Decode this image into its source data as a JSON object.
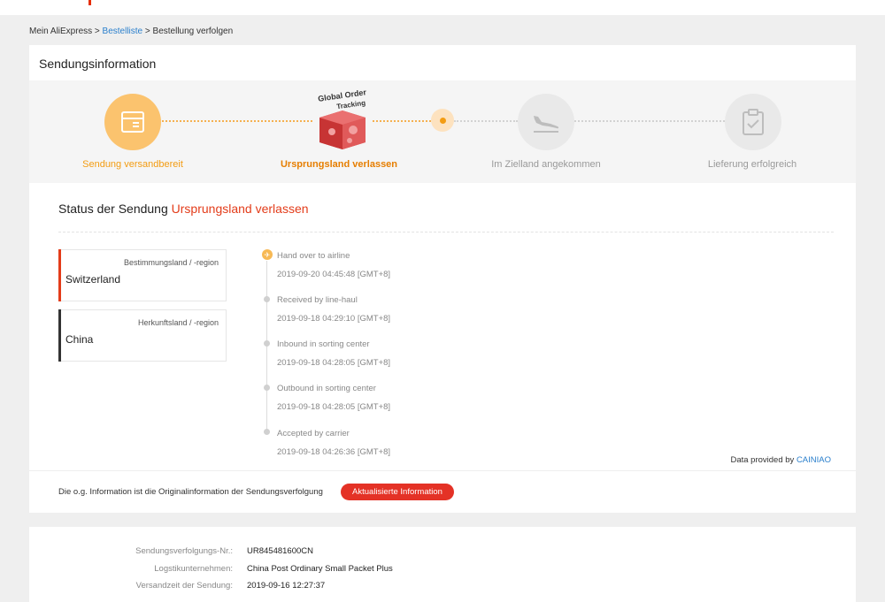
{
  "breadcrumb": {
    "home": "Mein AliExpress",
    "sep1": ">",
    "list": "Bestelliste",
    "sep2": ">",
    "current": "Bestellung verfolgen"
  },
  "card_title": "Sendungsinformation",
  "steps": [
    {
      "label": "Sendung versandbereit",
      "icon": "package-icon"
    },
    {
      "label": "Ursprungsland verlassen",
      "icon": "global-order-tracking-box"
    },
    {
      "label": "Im Zielland angekommen",
      "icon": "airplane-landing-icon"
    },
    {
      "label": "Lieferung erfolgreich",
      "icon": "clipboard-check-icon"
    }
  ],
  "badge": {
    "line1": "Global Order",
    "line2": "Tracking"
  },
  "status": {
    "prefix": "Status der Sendung",
    "value": "Ursprungsland verlassen"
  },
  "destination": {
    "label": "Bestimmungsland / -region",
    "value": "Switzerland"
  },
  "origin": {
    "label": "Herkunftsland / -region",
    "value": "China"
  },
  "events": [
    {
      "text": "Hand over to airline",
      "date": "2019-09-20 04:45:48 [GMT+8]"
    },
    {
      "text": "Received by line-haul",
      "date": "2019-09-18 04:29:10 [GMT+8]"
    },
    {
      "text": "Inbound in sorting center",
      "date": "2019-09-18 04:28:05 [GMT+8]"
    },
    {
      "text": "Outbound in sorting center",
      "date": "2019-09-18 04:28:05 [GMT+8]"
    },
    {
      "text": "Accepted by carrier",
      "date": "2019-09-18 04:26:36 [GMT+8]"
    }
  ],
  "provided": {
    "prefix": "Data provided by",
    "link": "CAINIAO"
  },
  "footer": {
    "note": "Die o.g. Information ist die Originalinformation der Sendungsverfolgung",
    "button": "Aktualisierte Information"
  },
  "shipment": {
    "tracking_label": "Sendungsverfolgungs-Nr.:",
    "tracking_value": "UR845481600CN",
    "carrier_label": "Logstikunternehmen:",
    "carrier_value": "China Post Ordinary Small Packet Plus",
    "date_label": "Versandzeit der Sendung:",
    "date_value": "2019-09-16 12:27:37"
  },
  "colors": {
    "accent": "#f39c12",
    "highlight": "#e33c1a",
    "button": "#e43226",
    "link": "#2a7fcc"
  }
}
